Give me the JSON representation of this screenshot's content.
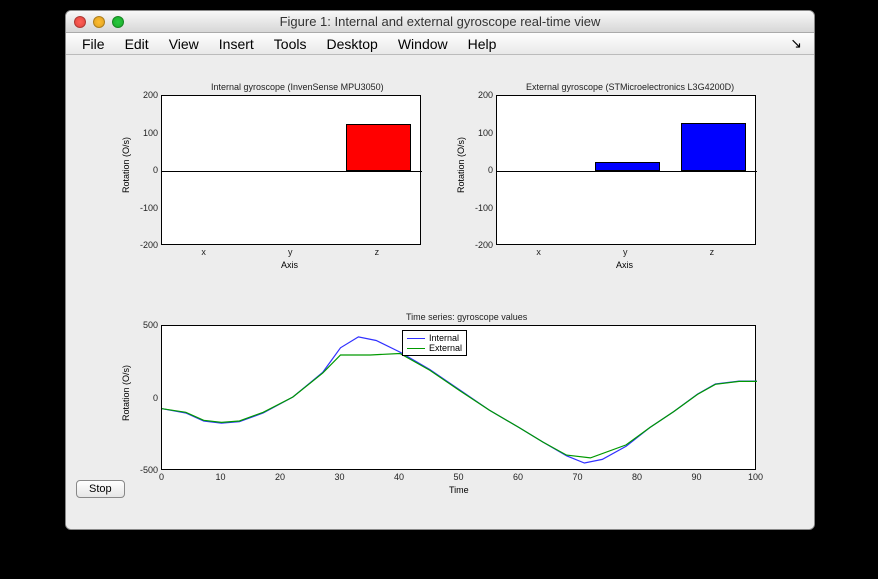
{
  "window": {
    "title": "Figure 1: Internal and external gyroscope real-time view"
  },
  "menubar": {
    "items": [
      "File",
      "Edit",
      "View",
      "Insert",
      "Tools",
      "Desktop",
      "Window",
      "Help"
    ],
    "scribble": "↘"
  },
  "button": {
    "stop": "Stop"
  },
  "chart_data": [
    {
      "type": "bar",
      "title": "Internal gyroscope (InvenSense MPU3050)",
      "xlabel": "Axis",
      "ylabel": "Rotation (O/s)",
      "categories": [
        "x",
        "y",
        "z"
      ],
      "values": [
        0,
        2,
        125
      ],
      "ylim": [
        -200,
        200
      ],
      "yticks": [
        -200,
        -100,
        0,
        100,
        200
      ],
      "color": "#ff0000"
    },
    {
      "type": "bar",
      "title": "External gyroscope (STMicroelectronics L3G4200D)",
      "xlabel": "Axis",
      "ylabel": "Rotation (O/s)",
      "categories": [
        "x",
        "y",
        "z"
      ],
      "values": [
        0,
        25,
        128
      ],
      "ylim": [
        -200,
        200
      ],
      "yticks": [
        -200,
        -100,
        0,
        100,
        200
      ],
      "color": "#0000ff"
    },
    {
      "type": "line",
      "title": "Time series: gyroscope values",
      "xlabel": "Time",
      "ylabel": "Rotation (O/s)",
      "xlim": [
        0,
        100
      ],
      "ylim": [
        -500,
        500
      ],
      "xticks": [
        0,
        10,
        20,
        30,
        40,
        50,
        60,
        70,
        80,
        90,
        100
      ],
      "yticks": [
        -500,
        0,
        500
      ],
      "series": [
        {
          "name": "Internal",
          "color": "#3030ff",
          "x": [
            0,
            4,
            7,
            10,
            13,
            17,
            22,
            27,
            30,
            33,
            36,
            40,
            45,
            50,
            55,
            60,
            64,
            68,
            71,
            74,
            78,
            82,
            86,
            90,
            93,
            97,
            100
          ],
          "y": [
            -70,
            -100,
            -155,
            -170,
            -160,
            -100,
            10,
            180,
            350,
            425,
            400,
            320,
            200,
            60,
            -80,
            -200,
            -300,
            -395,
            -445,
            -420,
            -330,
            -200,
            -90,
            30,
            100,
            120,
            120
          ]
        },
        {
          "name": "External",
          "color": "#009900",
          "x": [
            0,
            4,
            7,
            10,
            13,
            17,
            22,
            27,
            30,
            35,
            40,
            45,
            50,
            55,
            60,
            64,
            68,
            72,
            78,
            82,
            86,
            90,
            93,
            97,
            100
          ],
          "y": [
            -70,
            -95,
            -150,
            -165,
            -155,
            -95,
            10,
            175,
            300,
            300,
            310,
            195,
            55,
            -80,
            -200,
            -300,
            -390,
            -410,
            -320,
            -200,
            -90,
            28,
            98,
            118,
            118
          ]
        }
      ],
      "legend": [
        "Internal",
        "External"
      ]
    }
  ]
}
